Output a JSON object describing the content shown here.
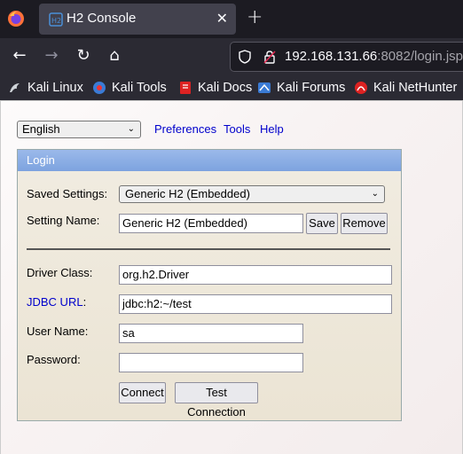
{
  "browser": {
    "tab": {
      "title": "H2 Console"
    },
    "url": {
      "host": "192.168.131.66",
      "rest": ":8082/login.jsp"
    },
    "bookmarks": [
      "Kali Linux",
      "Kali Tools",
      "Kali Docs",
      "Kali Forums",
      "Kali NetHunter"
    ]
  },
  "page": {
    "language": "English",
    "links": {
      "preferences": "Preferences",
      "tools": "Tools",
      "help": "Help"
    },
    "login": {
      "header": "Login",
      "saved_settings_label": "Saved Settings:",
      "saved_settings_value": "Generic H2 (Embedded)",
      "setting_name_label": "Setting Name:",
      "setting_name_value": "Generic H2 (Embedded)",
      "save_label": "Save",
      "remove_label": "Remove",
      "driver_class_label": "Driver Class:",
      "driver_class_value": "org.h2.Driver",
      "jdbc_url_label": "JDBC URL",
      "jdbc_url_colon": ":",
      "jdbc_url_value": "jdbc:h2:~/test",
      "user_name_label": "User Name:",
      "user_name_value": "sa",
      "password_label": "Password:",
      "password_value": "",
      "connect_label": "Connect",
      "test_connection_label": "Test Connection"
    }
  },
  "colors": {
    "link": "#0000cc",
    "header": "#8badE6",
    "panel": "#ede6d8"
  }
}
